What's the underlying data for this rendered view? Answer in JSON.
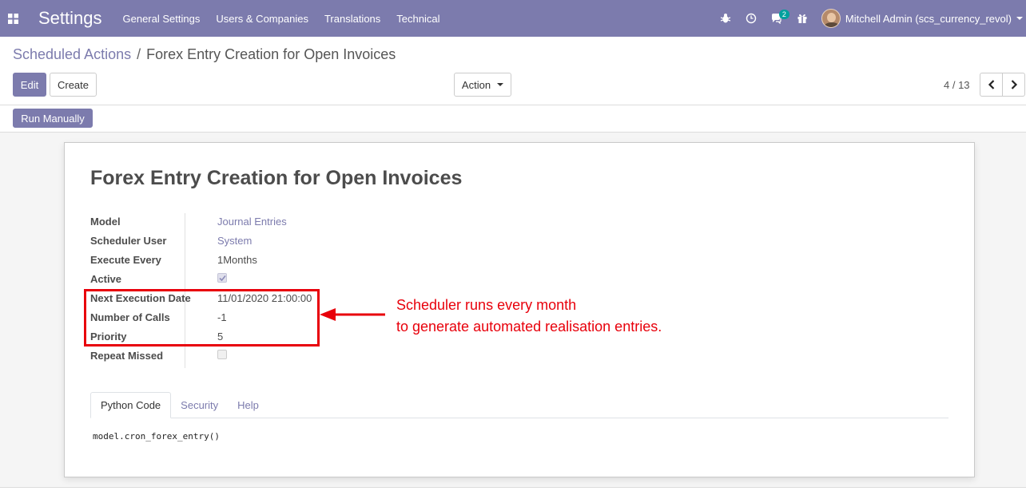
{
  "navbar": {
    "app_title": "Settings",
    "menu": [
      "General Settings",
      "Users & Companies",
      "Translations",
      "Technical"
    ],
    "messages_badge": "2",
    "user_name": "Mitchell Admin (scs_currency_revol)"
  },
  "breadcrumb": {
    "parent": "Scheduled Actions",
    "separator": "/",
    "current": "Forex Entry Creation for Open Invoices"
  },
  "buttons": {
    "edit": "Edit",
    "create": "Create",
    "action": "Action",
    "run_manually": "Run Manually"
  },
  "pager": {
    "value": "4 / 13"
  },
  "record": {
    "title": "Forex Entry Creation for Open Invoices",
    "fields": {
      "model": {
        "label": "Model",
        "value": "Journal Entries"
      },
      "scheduler_user": {
        "label": "Scheduler User",
        "value": "System"
      },
      "execute_every": {
        "label": "Execute Every",
        "value": "1Months"
      },
      "active": {
        "label": "Active",
        "checked": true
      },
      "next_execution_date": {
        "label": "Next Execution Date",
        "value": "11/01/2020 21:00:00"
      },
      "number_of_calls": {
        "label": "Number of Calls",
        "value": "-1"
      },
      "priority": {
        "label": "Priority",
        "value": "5"
      },
      "repeat_missed": {
        "label": "Repeat Missed",
        "checked": false
      }
    }
  },
  "tabs": [
    "Python Code",
    "Security",
    "Help"
  ],
  "active_tab": "Python Code",
  "code": "model.cron_forex_entry()",
  "annotation": {
    "line1": "Scheduler runs every month",
    "line2": "to generate automated realisation entries.",
    "color": "#e8000b"
  },
  "colors": {
    "brand": "#7c7bad"
  }
}
